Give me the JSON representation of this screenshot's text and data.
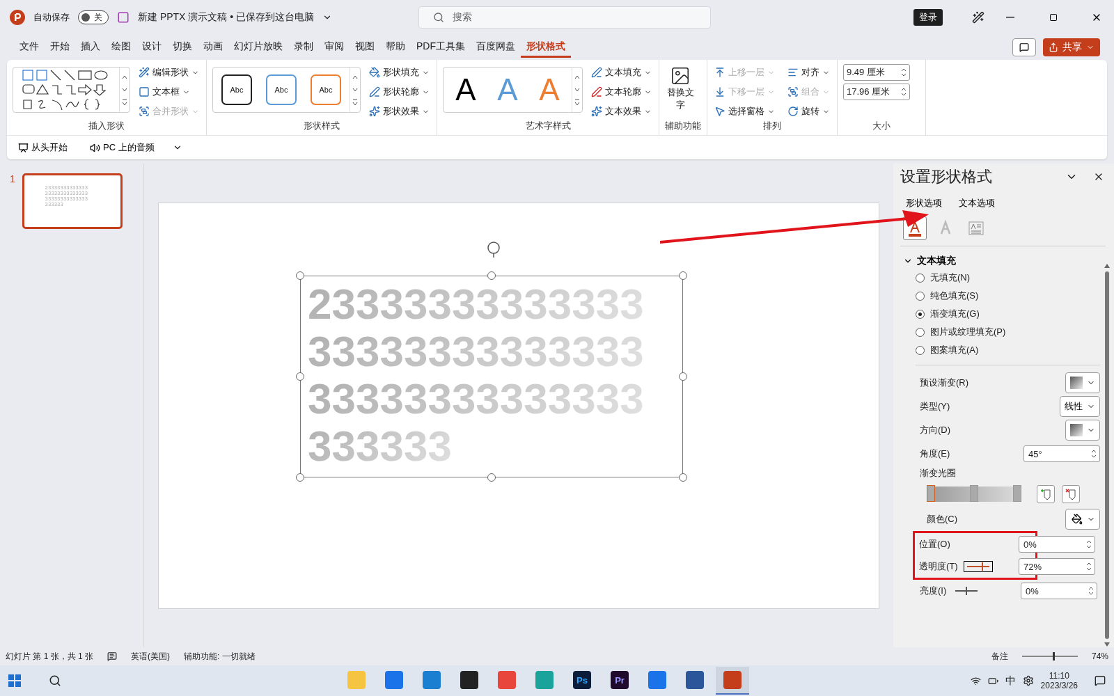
{
  "titlebar": {
    "autosave_label": "自动保存",
    "autosave_on": false,
    "autosave_state": "关",
    "document_title": "新建 PPTX 演示文稿 • 已保存到这台电脑",
    "search_placeholder": "搜索",
    "login": "登录"
  },
  "menu_tabs": [
    {
      "label": "文件",
      "selected": false
    },
    {
      "label": "开始",
      "selected": false
    },
    {
      "label": "插入",
      "selected": false
    },
    {
      "label": "绘图",
      "selected": false
    },
    {
      "label": "设计",
      "selected": false
    },
    {
      "label": "切换",
      "selected": false
    },
    {
      "label": "动画",
      "selected": false
    },
    {
      "label": "幻灯片放映",
      "selected": false
    },
    {
      "label": "录制",
      "selected": false
    },
    {
      "label": "审阅",
      "selected": false
    },
    {
      "label": "视图",
      "selected": false
    },
    {
      "label": "帮助",
      "selected": false
    },
    {
      "label": "PDF工具集",
      "selected": false
    },
    {
      "label": "百度网盘",
      "selected": false
    },
    {
      "label": "形状格式",
      "selected": true
    }
  ],
  "share": "共享",
  "ribbon": [
    {
      "kind": "shapes",
      "label": "插入形状",
      "commands": [
        {
          "label": "编辑形状",
          "disabled": false
        },
        {
          "label": "文本框",
          "disabled": false
        },
        {
          "label": "合并形状",
          "disabled": true
        }
      ]
    },
    {
      "kind": "styles",
      "label": "形状样式",
      "presets": [
        {
          "label": "Abc",
          "color": "#222222"
        },
        {
          "label": "Abc",
          "color": "#5b9bd5"
        },
        {
          "label": "Abc",
          "color": "#ed7d31"
        }
      ],
      "commands": [
        {
          "label": "形状填充",
          "disabled": false
        },
        {
          "label": "形状轮廓",
          "disabled": false
        },
        {
          "label": "形状效果",
          "disabled": false
        }
      ]
    },
    {
      "kind": "wordart",
      "label": "艺术字样式",
      "presets": [
        {
          "label": "A",
          "color": "#000000"
        },
        {
          "label": "A",
          "color": "#5b9bd5"
        },
        {
          "label": "A",
          "color": "#ed7d31"
        }
      ],
      "commands": [
        {
          "label": "文本填充",
          "disabled": false
        },
        {
          "label": "文本轮廓",
          "disabled": false
        },
        {
          "label": "文本效果",
          "disabled": false
        }
      ]
    },
    {
      "kind": "big",
      "label": "辅助功能",
      "commands": [
        {
          "label": "替换文字",
          "disabled": false
        }
      ]
    },
    {
      "kind": "arrange",
      "label": "排列",
      "commands": [
        {
          "label": "上移一层",
          "disabled": true
        },
        {
          "label": "对齐",
          "disabled": false
        },
        {
          "label": "下移一层",
          "disabled": true
        },
        {
          "label": "组合",
          "disabled": true
        },
        {
          "label": "选择窗格",
          "disabled": false
        },
        {
          "label": "旋转",
          "disabled": false
        }
      ]
    },
    {
      "kind": "size",
      "label": "大小",
      "fields": [
        {
          "value": "9.49 厘米"
        },
        {
          "value": "17.96 厘米"
        }
      ]
    }
  ],
  "quick_access": [
    {
      "label": "从头开始"
    },
    {
      "label": "PC 上的音频"
    }
  ],
  "thumbnail": {
    "number": "1",
    "lines": [
      "23333333333333",
      "33333333333333",
      "33333333333333",
      "333333"
    ]
  },
  "slide_text": [
    "23333333333333",
    "33333333333333",
    "33333333333333",
    "333333"
  ],
  "pane": {
    "title": "设置形状格式",
    "tabs": [
      {
        "label": "形状选项"
      },
      {
        "label": "文本选项"
      }
    ],
    "icon_tabs": [
      {
        "selected": true
      },
      {
        "selected": false
      },
      {
        "selected": false
      }
    ],
    "section": {
      "title": "文本填充",
      "expanded": true
    },
    "fills": [
      {
        "label": "无填充(N)",
        "selected": false
      },
      {
        "label": "纯色填充(S)",
        "selected": false
      },
      {
        "label": "渐变填充(G)",
        "selected": true
      },
      {
        "label": "图片或纹理填充(P)",
        "selected": false
      },
      {
        "label": "图案填充(A)",
        "selected": false
      }
    ],
    "preset": {
      "label": "预设渐变(R)"
    },
    "type": {
      "label": "类型(Y)",
      "value": "线性"
    },
    "direction": {
      "label": "方向(D)"
    },
    "angle": {
      "label": "角度(E)",
      "value": "45°"
    },
    "stops_label": "渐变光圈",
    "stops": [
      {
        "level": 0,
        "selected": true
      },
      {
        "level": 0.5,
        "selected": false
      },
      {
        "level": 1,
        "selected": false
      }
    ],
    "color": {
      "label": "颜色(C)"
    },
    "position": {
      "label": "位置(O)",
      "value": "0%"
    },
    "transparency": {
      "label": "透明度(T)",
      "level": 0.72,
      "value": "72%"
    },
    "brightness": {
      "label": "亮度(I)",
      "level": 0.5,
      "value": "0%"
    }
  },
  "status": {
    "slide": "幻灯片 第 1 张，共 1 张",
    "language": "英语(美国)",
    "accessibility": "辅助功能: 一切就绪",
    "notes": "备注",
    "zoom_slider": {
      "level": 0.55
    },
    "zoom": "74%"
  },
  "taskbar": {
    "apps": [
      {
        "kind": "folder"
      },
      {
        "kind": "search"
      },
      {
        "kind": "edge"
      },
      {
        "kind": "qq"
      },
      {
        "kind": "chrome"
      },
      {
        "kind": "edge-new"
      },
      {
        "kind": "ps",
        "label": "Ps"
      },
      {
        "kind": "pr",
        "label": "Pr"
      },
      {
        "kind": "search"
      },
      {
        "kind": "word"
      },
      {
        "kind": "ppt",
        "selected": true
      }
    ],
    "ime": "中",
    "time": "11:10",
    "date": "2023/3/26"
  }
}
